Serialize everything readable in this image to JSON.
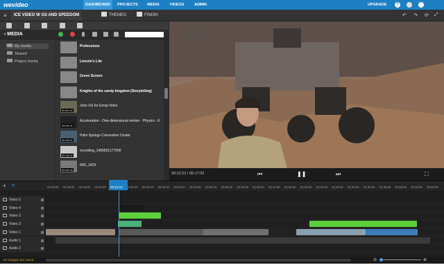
{
  "app": {
    "logo": "wevideo"
  },
  "topnav": {
    "tabs": [
      "DASHBOARD",
      "PROJECTS",
      "MEDIA",
      "VIDEOS",
      "ADMIN"
    ],
    "active": "DASHBOARD",
    "upgrade": "UPGRADE"
  },
  "project": {
    "name": "ICE VIDEO W GS AND SPEEDOM",
    "themes": "THEMES",
    "finish": "FINISH"
  },
  "media": {
    "title": "MEDIA",
    "folders": [
      "My media",
      "Shared",
      "Project media"
    ],
    "items": [
      {
        "name": "Professions",
        "duration": "",
        "bold": true,
        "folder": true
      },
      {
        "name": "Lincoln's Life",
        "duration": "",
        "bold": true,
        "folder": true
      },
      {
        "name": "Green Screen",
        "duration": "",
        "bold": true,
        "folder": true
      },
      {
        "name": "Knights of the candy kingdom (Storytelling)",
        "duration": "",
        "bold": true,
        "folder": true
      },
      {
        "name": "John GS for Emoji Video",
        "duration": "00:54:15",
        "bold": false,
        "folder": false
      },
      {
        "name": "Acceleration - One-dimensional motion - Physics - K",
        "duration": "09:05:14",
        "bold": false,
        "folder": false
      },
      {
        "name": "Palm Springs Convention Center",
        "duration": "00:28:22",
        "bold": false,
        "folder": false
      },
      {
        "name": "recording_1489531177000",
        "duration": "00:18:15",
        "bold": false,
        "folder": false
      },
      {
        "name": "IMG_2425",
        "duration": "00:09:18",
        "bold": false,
        "folder": false
      }
    ]
  },
  "preview": {
    "time": "00:22:23 / 05:17:02"
  },
  "timeline": {
    "playhead": "00:22:23",
    "ticks": [
      "00:00:00",
      "00:05:00",
      "00:10:00",
      "00:15:00",
      "00:20:00",
      "00:25:00",
      "00:30:00",
      "00:35:00",
      "00:40:00",
      "00:45:00",
      "00:50:00",
      "00:55:00",
      "01:00:00",
      "01:05:00",
      "01:10:00",
      "01:15:00",
      "01:20:00",
      "01:25:00",
      "01:30:00",
      "01:35:00",
      "01:40:00",
      "01:45:00",
      "01:50:00",
      "01:55:00",
      "02:00:00"
    ],
    "tracks": [
      "Video 5",
      "Video 4",
      "Video 3",
      "Video 2",
      "Video 1",
      "Audio 1",
      "Audio 2"
    ]
  },
  "status": {
    "saved": "All changes are saved"
  },
  "colors": {
    "brand": "#1d7fc4",
    "green_clip": "#5ccf3c",
    "status_text": "#d9a431"
  }
}
